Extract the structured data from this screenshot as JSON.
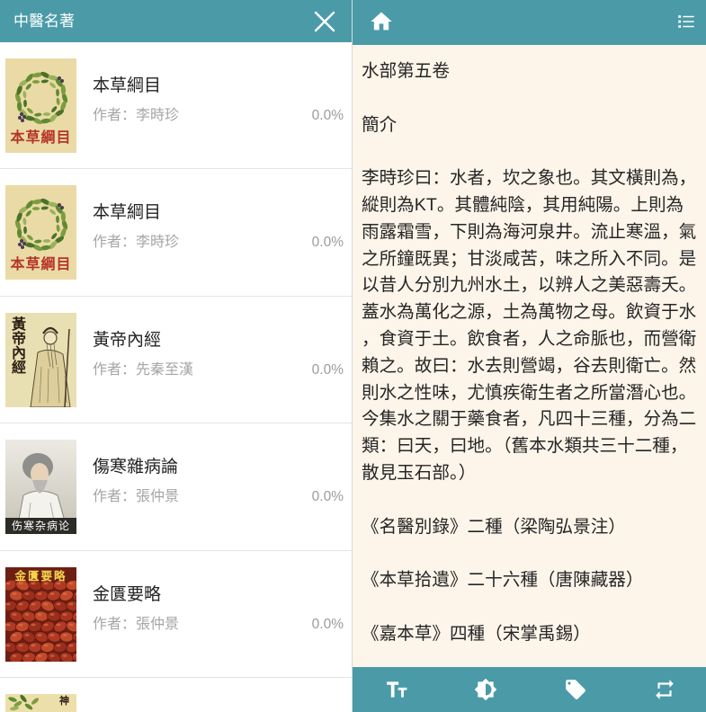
{
  "colors": {
    "accent": "#4a9ba7",
    "list_background": "#ffffff",
    "reader_background": "#fdf5ea",
    "title_text": "#222222",
    "muted_text": "#a5a5a5"
  },
  "library": {
    "header": {
      "title": "中醫名著",
      "close_icon": "close-icon"
    },
    "author_label": "作者：",
    "books": [
      {
        "title": "本草綱目",
        "author": "李時珍",
        "progress": "0.0%",
        "cover_text": "本草綱目"
      },
      {
        "title": "本草綱目",
        "author": "李時珍",
        "progress": "0.0%",
        "cover_text": "本草綱目"
      },
      {
        "title": "黃帝內經",
        "author": "先秦至漢",
        "progress": "0.0%",
        "cover_text": "黃帝內經"
      },
      {
        "title": "傷寒雜病論",
        "author": "張仲景",
        "progress": "0.0%",
        "cover_text": "伤寒杂病论"
      },
      {
        "title": "金匱要略",
        "author": "張仲景",
        "progress": "0.0%",
        "cover_text": "金匱要略"
      },
      {
        "cover_text": "神"
      }
    ]
  },
  "reader": {
    "header": {
      "home_icon": "home-icon",
      "menu_icon": "list-icon"
    },
    "chapter_title": "水部第五卷",
    "section_title": "簡介",
    "intro_lines": [
      "李時珍曰：水者，坎之象也。其文橫則為，",
      "縱則為KT。其體純陰，其用純陽。上則為",
      "雨露霜雪，下則為海河泉井。流止寒溫，氣",
      "之所鐘既異；甘淡咸苦，味之所入不同。是",
      "以昔人分別九州水土，以辨人之美惡壽夭。",
      "蓋水為萬化之源，土為萬物之母。飲資于水",
      "，食資于土。飲食者，人之命脈也，而營衛",
      "賴之。故曰：水去則營竭，谷去則衛亡。然",
      "則水之性味，尤慎疾衛生者之所當潛心也。",
      "今集水之關于藥食者，凡四十三種，分為二",
      "類：曰天，曰地。（舊本水類共三十二種，",
      "散見玉石部。）"
    ],
    "sources": [
      "《名醫別錄》二種（梁陶弘景注）",
      "《本草拾遺》二十六種（唐陳藏器）",
      "《嘉本草》四種（宋掌禹錫）"
    ],
    "toolbar": {
      "font_icon": "font-size-icon",
      "brightness_icon": "brightness-icon",
      "bookmark_icon": "tag-icon",
      "page_mode_icon": "swap-icon"
    }
  }
}
